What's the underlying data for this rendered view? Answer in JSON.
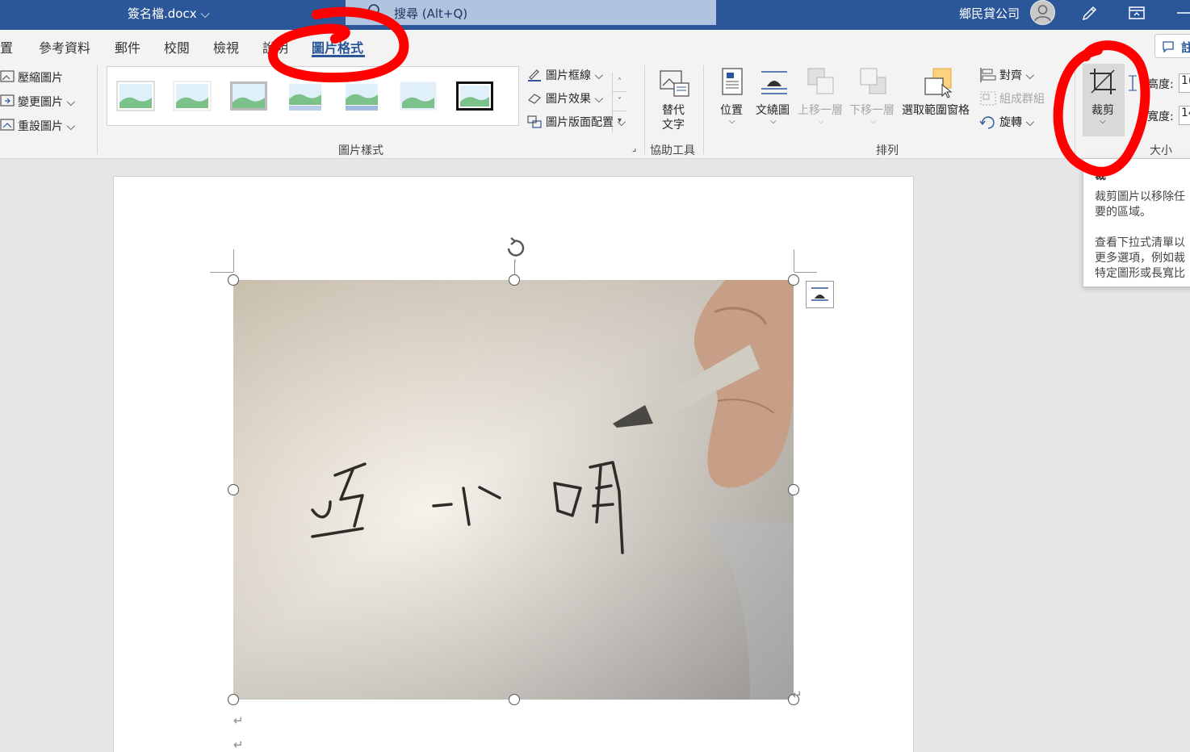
{
  "title_bar": {
    "doc_name": "簽名檔.docx ⌵",
    "search_placeholder": "搜尋 (Alt+Q)",
    "account": "鄉民貸公司"
  },
  "tabs": [
    {
      "label": "置"
    },
    {
      "label": "參考資料"
    },
    {
      "label": "郵件"
    },
    {
      "label": "校閱"
    },
    {
      "label": "檢視"
    },
    {
      "label": "說明"
    },
    {
      "label": "圖片格式",
      "active": true
    }
  ],
  "comment_label": "註",
  "ribbon": {
    "adjust": [
      "壓縮圖片",
      "變更圖片 ⌵",
      "重設圖片  ⌵"
    ],
    "picture_styles_label": "圖片樣式",
    "style_options": [
      "圖片框線 ⌵",
      "圖片效果 ⌵",
      "圖片版面配置 ⌵"
    ],
    "alt_text": [
      "替代",
      "文字"
    ],
    "accessibility_label": "協助工具",
    "arrange": {
      "position": "位置",
      "wrap_text": "文繞圖",
      "bring_forward": "上移一層",
      "send_backward": "下移一層",
      "selection_pane": "選取範圍窗格",
      "align": "對齊 ⌵",
      "group": "組成群組",
      "rotate": "旋轉 ⌵",
      "label": "排列"
    },
    "size": {
      "crop": "裁剪",
      "height_label": "高度:",
      "height_value": "1(",
      "width_label": "寬度:",
      "width_value": "14",
      "label": "大小"
    }
  },
  "document": {
    "signature_text": "王小明",
    "para_mark": "↵"
  },
  "tooltip": {
    "title": "裁",
    "lines": [
      "裁剪圖片以移除任",
      "要的區域。",
      "",
      "查看下拉式清單以",
      "更多選項，例如裁",
      "特定圖形或長寬比"
    ]
  },
  "colors": {
    "titlebar": "#2b579a",
    "accent": "#2b579a",
    "annotation": "#ff0000"
  }
}
